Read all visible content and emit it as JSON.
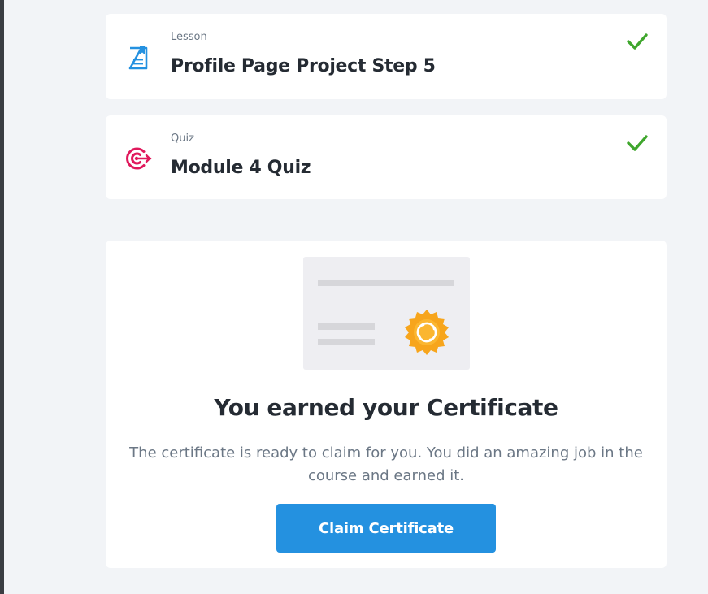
{
  "items": [
    {
      "type": "Lesson",
      "title": "Profile Page Project Step 5",
      "icon": "lesson-document-icon",
      "completed": true
    },
    {
      "type": "Quiz",
      "title": "Module 4 Quiz",
      "icon": "quiz-target-icon",
      "completed": true
    }
  ],
  "certificate": {
    "heading": "You earned your Certificate",
    "description_line1": "The certificate is ready to claim for you. You did an amazing job in the",
    "description_line2": "course and earned it.",
    "button_label": "Claim Certificate",
    "illustration": "certificate-illustration"
  },
  "colors": {
    "background": "#f2f4f7",
    "card": "#ffffff",
    "check": "#3fa62d",
    "lesson_icon": "#2491e0",
    "quiz_icon": "#e0195c",
    "button": "#2491e0",
    "seal": "#f7a51c"
  }
}
